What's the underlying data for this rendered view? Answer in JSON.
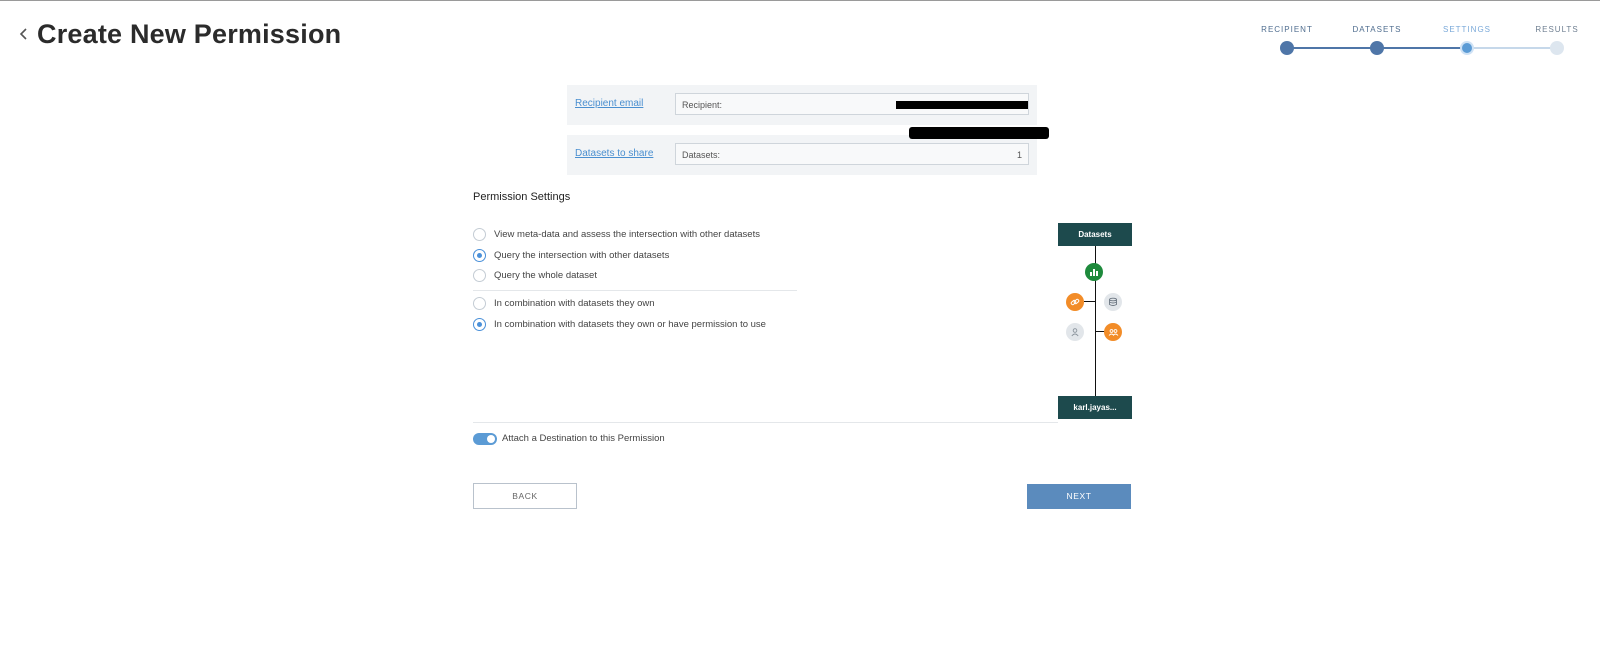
{
  "header": {
    "title": "Create New Permission"
  },
  "stepper": {
    "steps": [
      {
        "label": "RECIPIENT",
        "state": "complete"
      },
      {
        "label": "DATASETS",
        "state": "complete"
      },
      {
        "label": "SETTINGS",
        "state": "active"
      },
      {
        "label": "RESULTS",
        "state": "pending"
      }
    ]
  },
  "summary": {
    "recipient_link": "Recipient email",
    "recipient_label": "Recipient:",
    "datasets_link": "Datasets to share",
    "datasets_label": "Datasets:",
    "datasets_count": "1"
  },
  "settings": {
    "title": "Permission Settings",
    "access_options": [
      {
        "label": "View meta-data and assess the intersection with other datasets",
        "checked": false
      },
      {
        "label": "Query the intersection with other datasets",
        "checked": true
      },
      {
        "label": "Query the whole dataset",
        "checked": false
      }
    ],
    "scope_options": [
      {
        "label": "In combination with datasets they own",
        "checked": false
      },
      {
        "label": "In combination with datasets they own or have permission to use",
        "checked": true
      }
    ]
  },
  "diagram": {
    "top_label": "Datasets",
    "bottom_label": "karl.jayas...",
    "icons": [
      "bar-chart-icon",
      "link-icon",
      "database-icon",
      "user-icon",
      "group-icon"
    ],
    "colors": {
      "box": "#1d4a4d",
      "green": "#1e8a3c",
      "orange": "#f28c28",
      "gray": "#e2e6ea"
    }
  },
  "destination": {
    "label": "Attach a Destination to this Permission",
    "enabled": true
  },
  "buttons": {
    "back": "BACK",
    "next": "NEXT"
  },
  "colors": {
    "accent": "#4a90d9",
    "primary_button": "#5b8bbd",
    "step_complete": "#4f76a8"
  }
}
